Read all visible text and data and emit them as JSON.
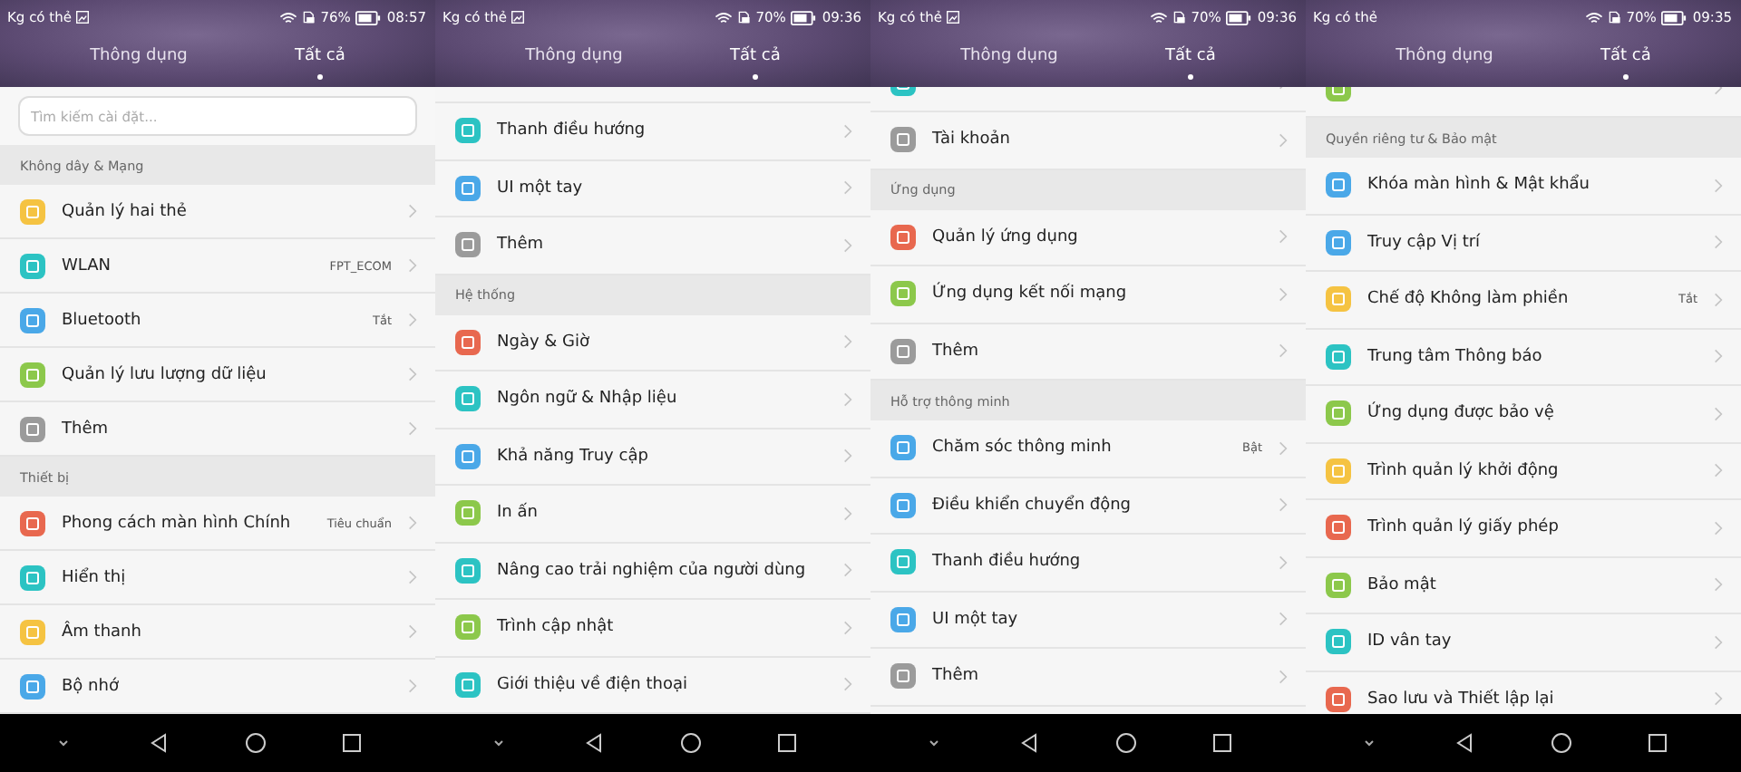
{
  "panels": [
    {
      "status": {
        "carrier": "Kg có thẻ",
        "image_notification": true,
        "battery": "76%",
        "time": "08:57"
      },
      "tabs": [
        {
          "label": "Thông dụng",
          "selected": false
        },
        {
          "label": "Tất cả",
          "selected": true
        }
      ],
      "rows": [
        {
          "kind": "search",
          "placeholder": "Tìm kiếm cài đặt..."
        },
        {
          "kind": "section",
          "label": "Không dây & Mạng"
        },
        {
          "kind": "item",
          "label": "Quản lý hai thẻ",
          "color": "#f5c342"
        },
        {
          "kind": "item",
          "label": "WLAN",
          "value": "FPT_ECOM",
          "color": "#2cc3c3"
        },
        {
          "kind": "item",
          "label": "Bluetooth",
          "value": "Tắt",
          "color": "#4aa8e8"
        },
        {
          "kind": "item",
          "label": "Quản lý lưu lượng dữ liệu",
          "color": "#8cc84b"
        },
        {
          "kind": "item",
          "label": "Thêm",
          "color": "#9b9b9b"
        },
        {
          "kind": "section",
          "label": "Thiết bị"
        },
        {
          "kind": "item",
          "label": "Phong cách màn hình Chính",
          "value": "Tiêu chuẩn",
          "color": "#e8684f"
        },
        {
          "kind": "item",
          "label": "Hiển thị",
          "color": "#2cc3c3"
        },
        {
          "kind": "item",
          "label": "Âm thanh",
          "color": "#f5c342"
        },
        {
          "kind": "item",
          "label": "Bộ nhớ",
          "color": "#4aa8e8"
        }
      ]
    },
    {
      "status": {
        "carrier": "Kg có thẻ",
        "image_notification": true,
        "battery": "70%",
        "time": "09:36"
      },
      "tabs": [
        {
          "label": "Thông dụng",
          "selected": false
        },
        {
          "label": "Tất cả",
          "selected": true
        }
      ],
      "rows": [
        {
          "kind": "clipped"
        },
        {
          "kind": "item",
          "label": "Thanh điều hướng",
          "color": "#2cc3c3"
        },
        {
          "kind": "item",
          "label": "UI một tay",
          "color": "#4aa8e8"
        },
        {
          "kind": "item",
          "label": "Thêm",
          "color": "#9b9b9b"
        },
        {
          "kind": "section",
          "label": "Hệ thống"
        },
        {
          "kind": "item",
          "label": "Ngày & Giờ",
          "color": "#e8684f"
        },
        {
          "kind": "item",
          "label": "Ngôn ngữ & Nhập liệu",
          "color": "#2cc3c3"
        },
        {
          "kind": "item",
          "label": "Khả năng Truy cập",
          "color": "#4aa8e8"
        },
        {
          "kind": "item",
          "label": "In ấn",
          "color": "#8cc84b"
        },
        {
          "kind": "item",
          "label": "Nâng cao trải nghiệm của người dùng",
          "color": "#2cc3c3"
        },
        {
          "kind": "item",
          "label": "Trình cập nhật",
          "color": "#8cc84b"
        },
        {
          "kind": "item",
          "label": "Giới thiệu về điện thoại",
          "color": "#2cc3c3"
        }
      ]
    },
    {
      "status": {
        "carrier": "Kg có thẻ",
        "image_notification": true,
        "battery": "70%",
        "time": "09:36"
      },
      "tabs": [
        {
          "label": "Thông dụng",
          "selected": false
        },
        {
          "label": "Tất cả",
          "selected": true
        }
      ],
      "rows": [
        {
          "kind": "clipped",
          "color": "#2cc3c3"
        },
        {
          "kind": "item",
          "label": "Tài khoản",
          "color": "#9b9b9b"
        },
        {
          "kind": "section",
          "label": "Ứng dụng"
        },
        {
          "kind": "item",
          "label": "Quản lý ứng dụng",
          "color": "#e8684f"
        },
        {
          "kind": "item",
          "label": "Ứng dụng kết nối mạng",
          "color": "#8cc84b"
        },
        {
          "kind": "item",
          "label": "Thêm",
          "color": "#9b9b9b"
        },
        {
          "kind": "section",
          "label": "Hỗ trợ thông minh"
        },
        {
          "kind": "item",
          "label": "Chăm sóc thông minh",
          "value": "Bật",
          "color": "#4aa8e8"
        },
        {
          "kind": "item",
          "label": "Điều khiển chuyển động",
          "color": "#4aa8e8"
        },
        {
          "kind": "item",
          "label": "Thanh điều hướng",
          "color": "#2cc3c3"
        },
        {
          "kind": "item",
          "label": "UI một tay",
          "color": "#4aa8e8"
        },
        {
          "kind": "item",
          "label": "Thêm",
          "color": "#9b9b9b"
        }
      ]
    },
    {
      "status": {
        "carrier": "Kg có thẻ",
        "image_notification": false,
        "battery": "70%",
        "time": "09:35"
      },
      "tabs": [
        {
          "label": "Thông dụng",
          "selected": false
        },
        {
          "label": "Tất cả",
          "selected": true
        }
      ],
      "rows": [
        {
          "kind": "clipped",
          "color": "#8cc84b"
        },
        {
          "kind": "section",
          "label": "Quyền riêng tư & Bảo mật"
        },
        {
          "kind": "item",
          "label": "Khóa màn hình & Mật khẩu",
          "color": "#4aa8e8"
        },
        {
          "kind": "item",
          "label": "Truy cập Vị trí",
          "color": "#4aa8e8"
        },
        {
          "kind": "item",
          "label": "Chế độ Không làm phiền",
          "value": "Tắt",
          "color": "#f5c342"
        },
        {
          "kind": "item",
          "label": "Trung tâm Thông báo",
          "color": "#2cc3c3"
        },
        {
          "kind": "item",
          "label": "Ứng dụng được bảo vệ",
          "color": "#8cc84b"
        },
        {
          "kind": "item",
          "label": "Trình quản lý khởi động",
          "color": "#f5c342"
        },
        {
          "kind": "item",
          "label": "Trình quản lý giấy phép",
          "color": "#e8684f"
        },
        {
          "kind": "item",
          "label": "Bảo mật",
          "color": "#8cc84b"
        },
        {
          "kind": "item",
          "label": "ID vân tay",
          "color": "#2cc3c3"
        },
        {
          "kind": "item",
          "label": "Sao lưu và Thiết lập lại",
          "color": "#e8684f"
        }
      ]
    }
  ]
}
